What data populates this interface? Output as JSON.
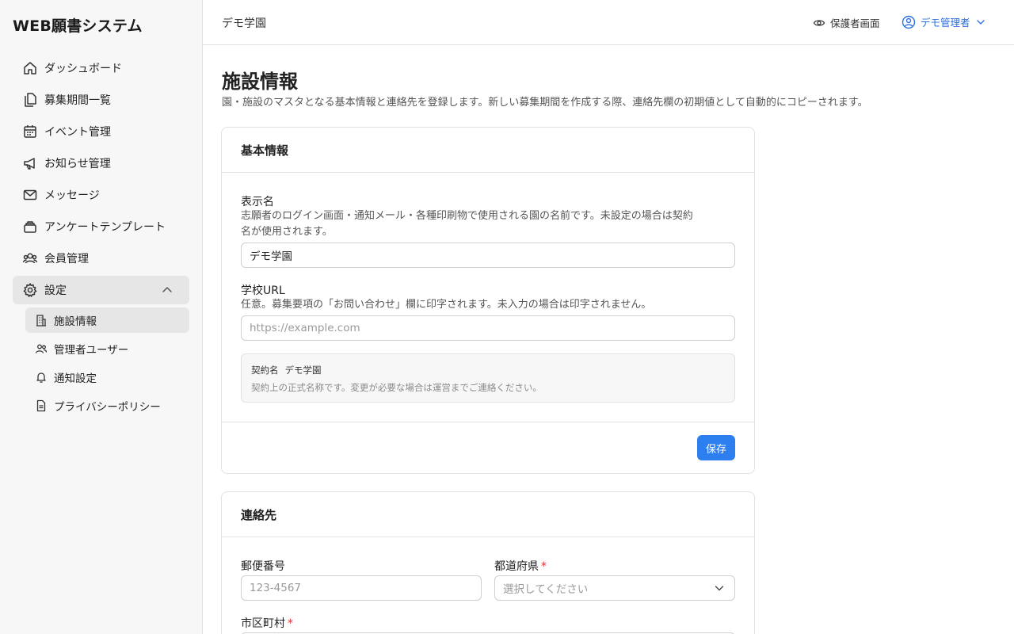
{
  "app": {
    "title": "WEB願書システム"
  },
  "sidebar": {
    "items": [
      {
        "label": "ダッシュボード",
        "icon": "home-icon"
      },
      {
        "label": "募集期間一覧",
        "icon": "documents-icon"
      },
      {
        "label": "イベント管理",
        "icon": "calendar-icon"
      },
      {
        "label": "お知らせ管理",
        "icon": "megaphone-icon"
      },
      {
        "label": "メッセージ",
        "icon": "mail-icon"
      },
      {
        "label": "アンケートテンプレート",
        "icon": "stack-icon"
      },
      {
        "label": "会員管理",
        "icon": "users-icon"
      },
      {
        "label": "設定",
        "icon": "gear-icon"
      }
    ],
    "settings_sub": [
      {
        "label": "施設情報",
        "icon": "building-icon",
        "active": true
      },
      {
        "label": "管理者ユーザー",
        "icon": "users-icon"
      },
      {
        "label": "通知設定",
        "icon": "bell-icon"
      },
      {
        "label": "プライバシーポリシー",
        "icon": "document-icon"
      }
    ]
  },
  "topbar": {
    "org_name": "デモ学園",
    "guardian_view": "保護者画面",
    "user_name": "デモ管理者"
  },
  "page": {
    "title": "施設情報",
    "description": "園・施設のマスタとなる基本情報と連絡先を登録します。新しい募集期間を作成する際、連絡先欄の初期値として自動的にコピーされます。"
  },
  "basic_info": {
    "heading": "基本情報",
    "display_name": {
      "label": "表示名",
      "help_line1": "志願者のログイン画面・通知メール・各種印刷物で使用される園の名前です。未設定の場合は契約",
      "help_line2": "名が使用されます。",
      "value": "デモ学園"
    },
    "school_url": {
      "label": "学校URL",
      "help": "任意。募集要項の「お問い合わせ」欄に印字されます。未入力の場合は印字されません。",
      "placeholder": "https://example.com"
    },
    "contract": {
      "label": "契約名",
      "value": "デモ学園",
      "note": "契約上の正式名称です。変更が必要な場合は運営までご連絡ください。"
    },
    "save_label": "保存"
  },
  "contact": {
    "heading": "連絡先",
    "postal_code": {
      "label": "郵便番号",
      "placeholder": "123-4567"
    },
    "prefecture": {
      "label": "都道府県",
      "required": "*",
      "placeholder": "選択してください"
    },
    "city": {
      "label": "市区町村",
      "required": "*"
    }
  },
  "colors": {
    "accent": "#2d7ff0",
    "required": "#e03131",
    "sidebar_bg": "#f7f7f7"
  }
}
